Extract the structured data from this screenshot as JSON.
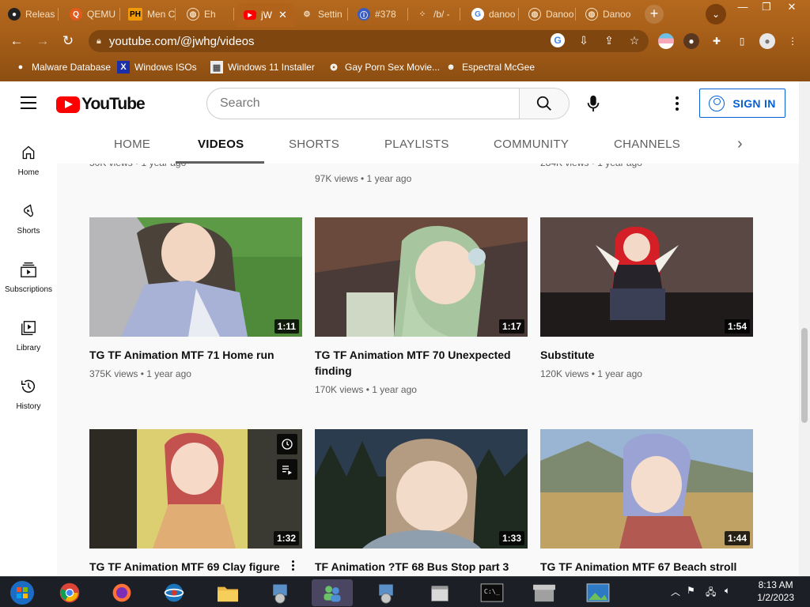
{
  "browser": {
    "tabs": [
      {
        "label": "Releas",
        "icon": "github-icon"
      },
      {
        "label": "QEMU",
        "icon": "qemu-icon"
      },
      {
        "label": "Men C",
        "icon": "ph-icon"
      },
      {
        "label": "Eh",
        "icon": "globe-icon"
      },
      {
        "label": "jW",
        "icon": "youtube-icon",
        "active": true
      },
      {
        "label": "Settin",
        "icon": "gear-icon"
      },
      {
        "label": "#378",
        "icon": "github-issue-icon"
      },
      {
        "label": "/b/ -",
        "icon": "grid-icon"
      },
      {
        "label": "danoo",
        "icon": "google-icon"
      },
      {
        "label": "Danoo",
        "icon": "globe-icon"
      },
      {
        "label": "Danoo",
        "icon": "globe-icon"
      }
    ],
    "ph_badge": "PH",
    "new_tab": "+",
    "tab_menu": "⌄",
    "window_controls": {
      "minimize": "—",
      "restore": "❐",
      "close": "✕"
    },
    "url": "youtube.com/@jwhg/videos",
    "bookmarks": [
      {
        "label": "Malware Database",
        "icon": "github-icon"
      },
      {
        "label": "Windows ISOs",
        "icon": "x-icon"
      },
      {
        "label": "Windows 11 Installer",
        "icon": "image-icon"
      },
      {
        "label": "Gay Porn Sex Movie...",
        "icon": "film-icon"
      },
      {
        "label": "Espectral McGee",
        "icon": "avatar-icon"
      }
    ]
  },
  "youtube": {
    "logo_text": "YouTube",
    "search_placeholder": "Search",
    "sign_in": "SIGN IN",
    "guide": [
      {
        "label": "Home",
        "icon": "home-icon"
      },
      {
        "label": "Shorts",
        "icon": "shorts-icon"
      },
      {
        "label": "Subscriptions",
        "icon": "subscriptions-icon"
      },
      {
        "label": "Library",
        "icon": "library-icon"
      },
      {
        "label": "History",
        "icon": "history-icon"
      }
    ],
    "channel_tabs": [
      "HOME",
      "VIDEOS",
      "SHORTS",
      "PLAYLISTS",
      "COMMUNITY",
      "CHANNELS"
    ],
    "selected_tab": "VIDEOS",
    "partial_row": [
      {
        "meta": "50K views • 1 year ago"
      },
      {
        "meta": "97K views • 1 year ago"
      },
      {
        "meta": "284K views • 1 year ago"
      }
    ],
    "videos": [
      {
        "title": "TG TF Animation MTF 71 Home run",
        "duration": "1:11",
        "meta": "375K views • 1 year ago"
      },
      {
        "title": "TG TF Animation MTF 70 Unexpected finding",
        "duration": "1:17",
        "meta": "170K views • 1 year ago"
      },
      {
        "title": "Substitute",
        "duration": "1:54",
        "meta": "120K views • 1 year ago"
      },
      {
        "title": "TG TF Animation MTF 69 Clay figure",
        "duration": "1:32",
        "meta": ""
      },
      {
        "title": "TF Animation ?TF 68 Bus Stop part 3",
        "duration": "1:33",
        "meta": ""
      },
      {
        "title": "TG TF Animation MTF 67 Beach stroll",
        "duration": "1:44",
        "meta": ""
      }
    ]
  },
  "taskbar": {
    "clock_time": "8:13 AM",
    "clock_date": "1/2/2023"
  }
}
